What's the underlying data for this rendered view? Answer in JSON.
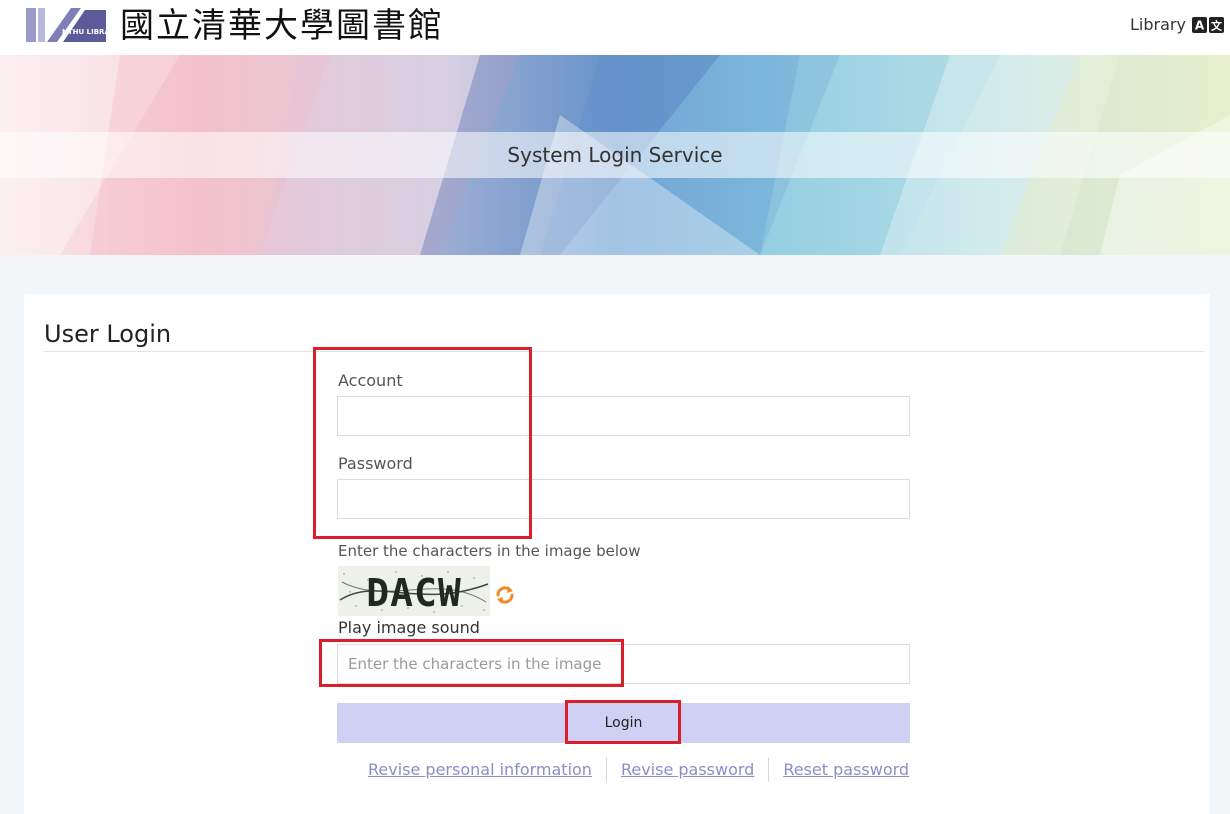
{
  "header": {
    "logo_text": "NTHU LIBRARY",
    "site_title": "國立清華大學圖書館",
    "nav_library": "Library",
    "language_icon": "translate-icon"
  },
  "banner": {
    "title": "System Login Service"
  },
  "login": {
    "heading": "User Login",
    "account_label": "Account",
    "account_value": "",
    "password_label": "Password",
    "password_value": "",
    "captcha_instruction": "Enter the characters in the image below",
    "captcha_text": "DACW",
    "refresh_icon": "refresh-icon",
    "play_sound": "Play image sound",
    "captcha_placeholder": "Enter the characters in the image",
    "captcha_value": "",
    "login_button": "Login"
  },
  "footer_links": [
    {
      "label": "Revise personal information"
    },
    {
      "label": "Revise password"
    },
    {
      "label": "Reset password"
    }
  ],
  "colors": {
    "accent_button": "#cfd0f3",
    "link": "#8a8fc8",
    "annotation": "#d9202a"
  }
}
